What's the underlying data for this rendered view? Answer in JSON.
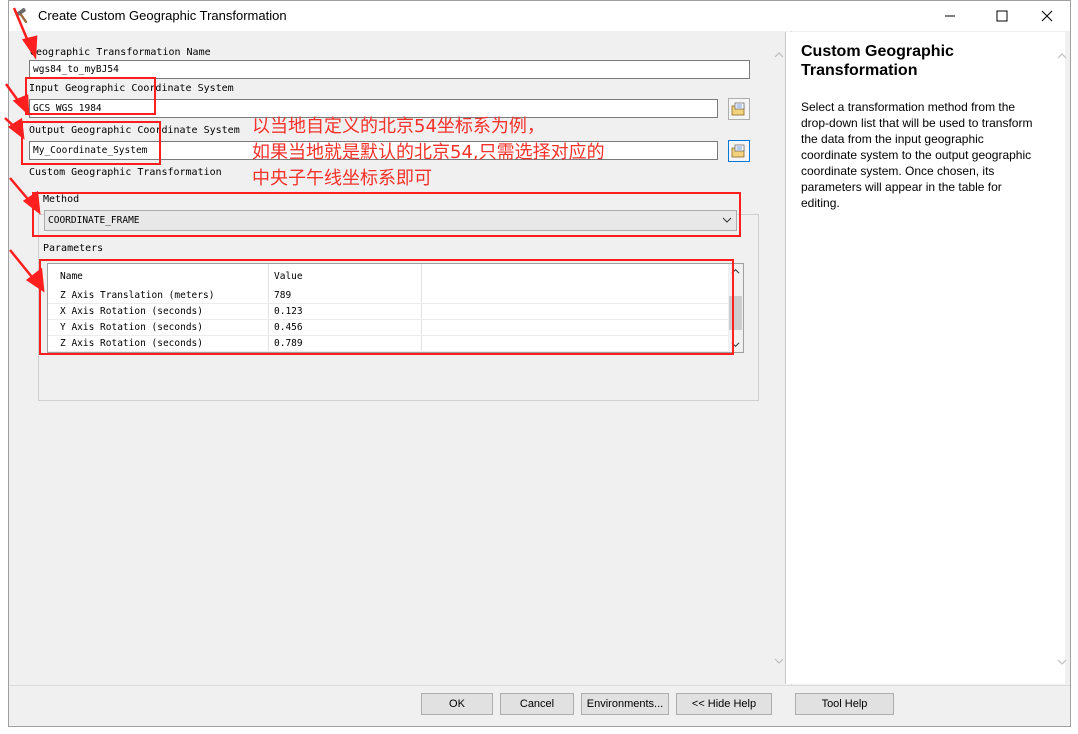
{
  "window": {
    "title": "Create Custom Geographic Transformation"
  },
  "form": {
    "name_label": "Geographic Transformation Name",
    "name_value": "wgs84_to_myBJ54",
    "input_gcs_label": "Input Geographic Coordinate System",
    "input_gcs_value": "GCS_WGS_1984",
    "output_gcs_label": "Output Geographic Coordinate System",
    "output_gcs_value": "My_Coordinate_System",
    "custom_label": "Custom Geographic Transformation",
    "method_label": "Method",
    "method_value": "COORDINATE_FRAME",
    "parameters_label": "Parameters"
  },
  "parameters_table": {
    "columns": [
      "Name",
      "Value"
    ],
    "rows": [
      {
        "name": "Z Axis Translation (meters)",
        "value": "789"
      },
      {
        "name": "X Axis Rotation (seconds)",
        "value": "0.123"
      },
      {
        "name": "Y Axis Rotation (seconds)",
        "value": "0.456"
      },
      {
        "name": "Z Axis Rotation (seconds)",
        "value": "0.789"
      }
    ]
  },
  "annotation": {
    "line1": "以当地自定义的北京54坐标系为例，",
    "line2": "如果当地就是默认的北京54,只需选择对应的",
    "line3": "中央子午线坐标系即可",
    "color": "#f4312a"
  },
  "help": {
    "title": "Custom Geographic Transformation",
    "body": "Select a transformation method from the drop-down list that will be used to transform the data from the input geographic coordinate system to the output geographic coordinate system. Once chosen, its parameters will appear in the table for editing."
  },
  "buttons": {
    "ok": "OK",
    "cancel": "Cancel",
    "environments": "Environments...",
    "hide_help": "<< Hide Help",
    "tool_help": "Tool Help"
  },
  "icons": {
    "title": "hammer-icon",
    "minimize": "minimize-icon",
    "maximize": "maximize-icon",
    "close": "close-icon",
    "browse": "folder-browse-icon",
    "dropdown": "chevron-down-icon"
  },
  "colors": {
    "highlight": "#ff1f1f",
    "focus": "#0078d7"
  }
}
